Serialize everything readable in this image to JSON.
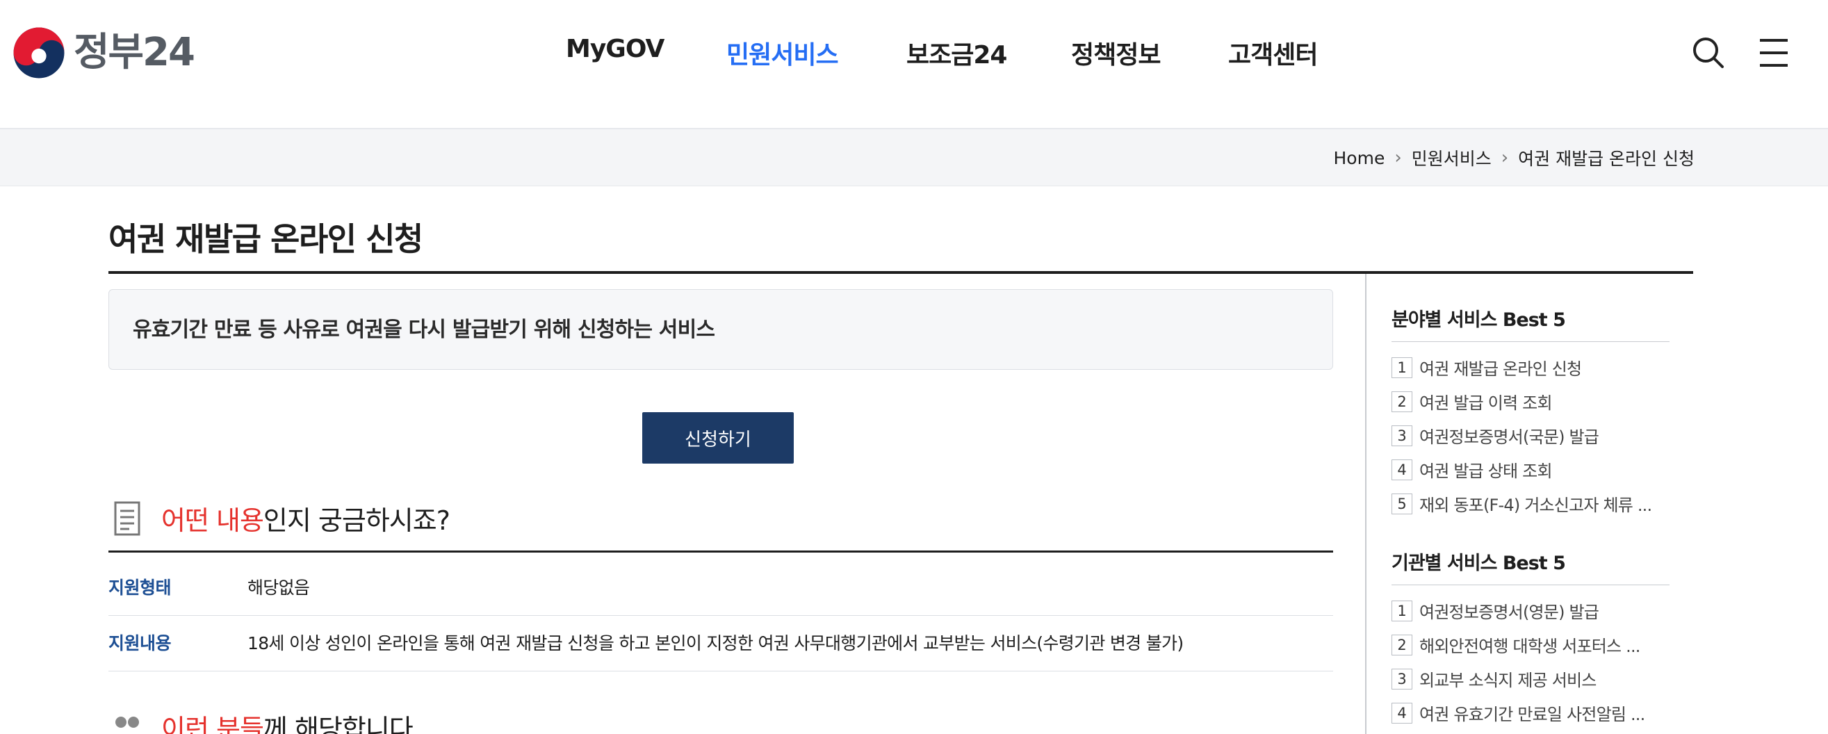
{
  "header": {
    "logo_text": "정부24",
    "nav": [
      {
        "label": "MyGOV",
        "active": false
      },
      {
        "label": "민원서비스",
        "active": true
      },
      {
        "label": "보조금24",
        "active": false
      },
      {
        "label": "정책정보",
        "active": false
      },
      {
        "label": "고객센터",
        "active": false
      }
    ],
    "icons": [
      "search-icon",
      "menu-icon"
    ]
  },
  "breadcrumb": {
    "items": [
      "Home",
      "민원서비스",
      "여권 재발급 온라인 신청"
    ]
  },
  "page": {
    "title": "여권 재발급 온라인 신청",
    "summary": "유효기간 만료 등 사유로 여권을 다시 발급받기 위해 신청하는 서비스",
    "apply_label": "신청하기"
  },
  "section1": {
    "title_highlight": "어떤 내용",
    "title_rest": "인지 궁금하시죠?",
    "rows": [
      {
        "label": "지원형태",
        "value": "해당없음"
      },
      {
        "label": "지원내용",
        "value": "18세 이상 성인이 온라인을 통해 여권 재발급 신청을 하고 본인이 지정한 여권 사무대행기관에서 교부받는 서비스(수령기관 변경 불가)"
      }
    ]
  },
  "section2": {
    "title_highlight": "이런 분들",
    "title_rest": "께 해당합니다"
  },
  "sidebar": {
    "best_by_field": {
      "title": "분야별 서비스 Best 5",
      "items": [
        {
          "num": "1",
          "text": "여권 재발급 온라인 신청"
        },
        {
          "num": "2",
          "text": "여권 발급 이력 조회"
        },
        {
          "num": "3",
          "text": "여권정보증명서(국문) 발급"
        },
        {
          "num": "4",
          "text": "여권 발급 상태 조회"
        },
        {
          "num": "5",
          "text": "재외 동포(F-4) 거소신고자 체류 ..."
        }
      ]
    },
    "best_by_agency": {
      "title": "기관별 서비스 Best 5",
      "items": [
        {
          "num": "1",
          "text": "여권정보증명서(영문) 발급"
        },
        {
          "num": "2",
          "text": "해외안전여행 대학생 서포터스 ..."
        },
        {
          "num": "3",
          "text": "외교부 소식지 제공 서비스"
        },
        {
          "num": "4",
          "text": "여권 유효기간 만료일 사전알림 ..."
        }
      ]
    }
  },
  "colors": {
    "accent_blue": "#256ef4",
    "button_navy": "#1c3a66",
    "highlight_red": "#e5322d",
    "label_blue": "#1d4f94"
  }
}
